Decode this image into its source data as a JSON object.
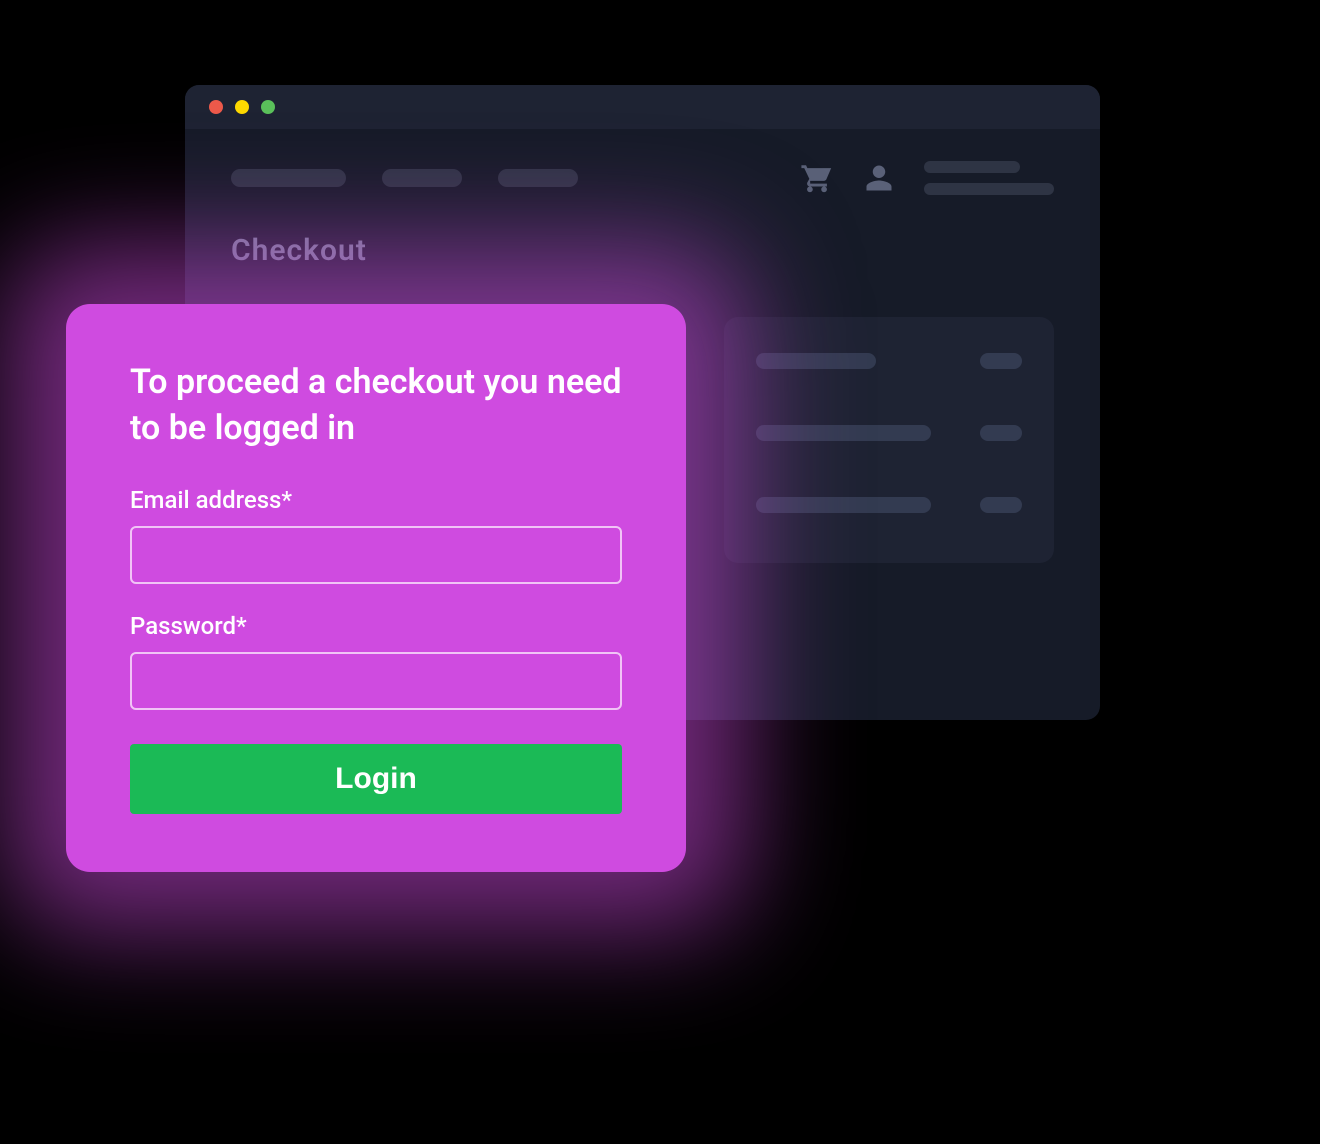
{
  "window": {
    "traffic_lights": {
      "red": "#ED594A",
      "yellow": "#FDD800",
      "green": "#5AC05A"
    },
    "page_title": "Checkout",
    "icons": {
      "cart": "cart-icon",
      "user": "user-icon"
    }
  },
  "login_popup": {
    "heading": "To proceed a checkout you need to be logged in",
    "email_label": "Email address*",
    "password_label": "Password*",
    "email_value": "",
    "password_value": "",
    "submit_label": "Login"
  },
  "colors": {
    "popup_bg": "#CF4BE0",
    "button_green": "#1BBA56",
    "window_bg": "#161B28"
  }
}
